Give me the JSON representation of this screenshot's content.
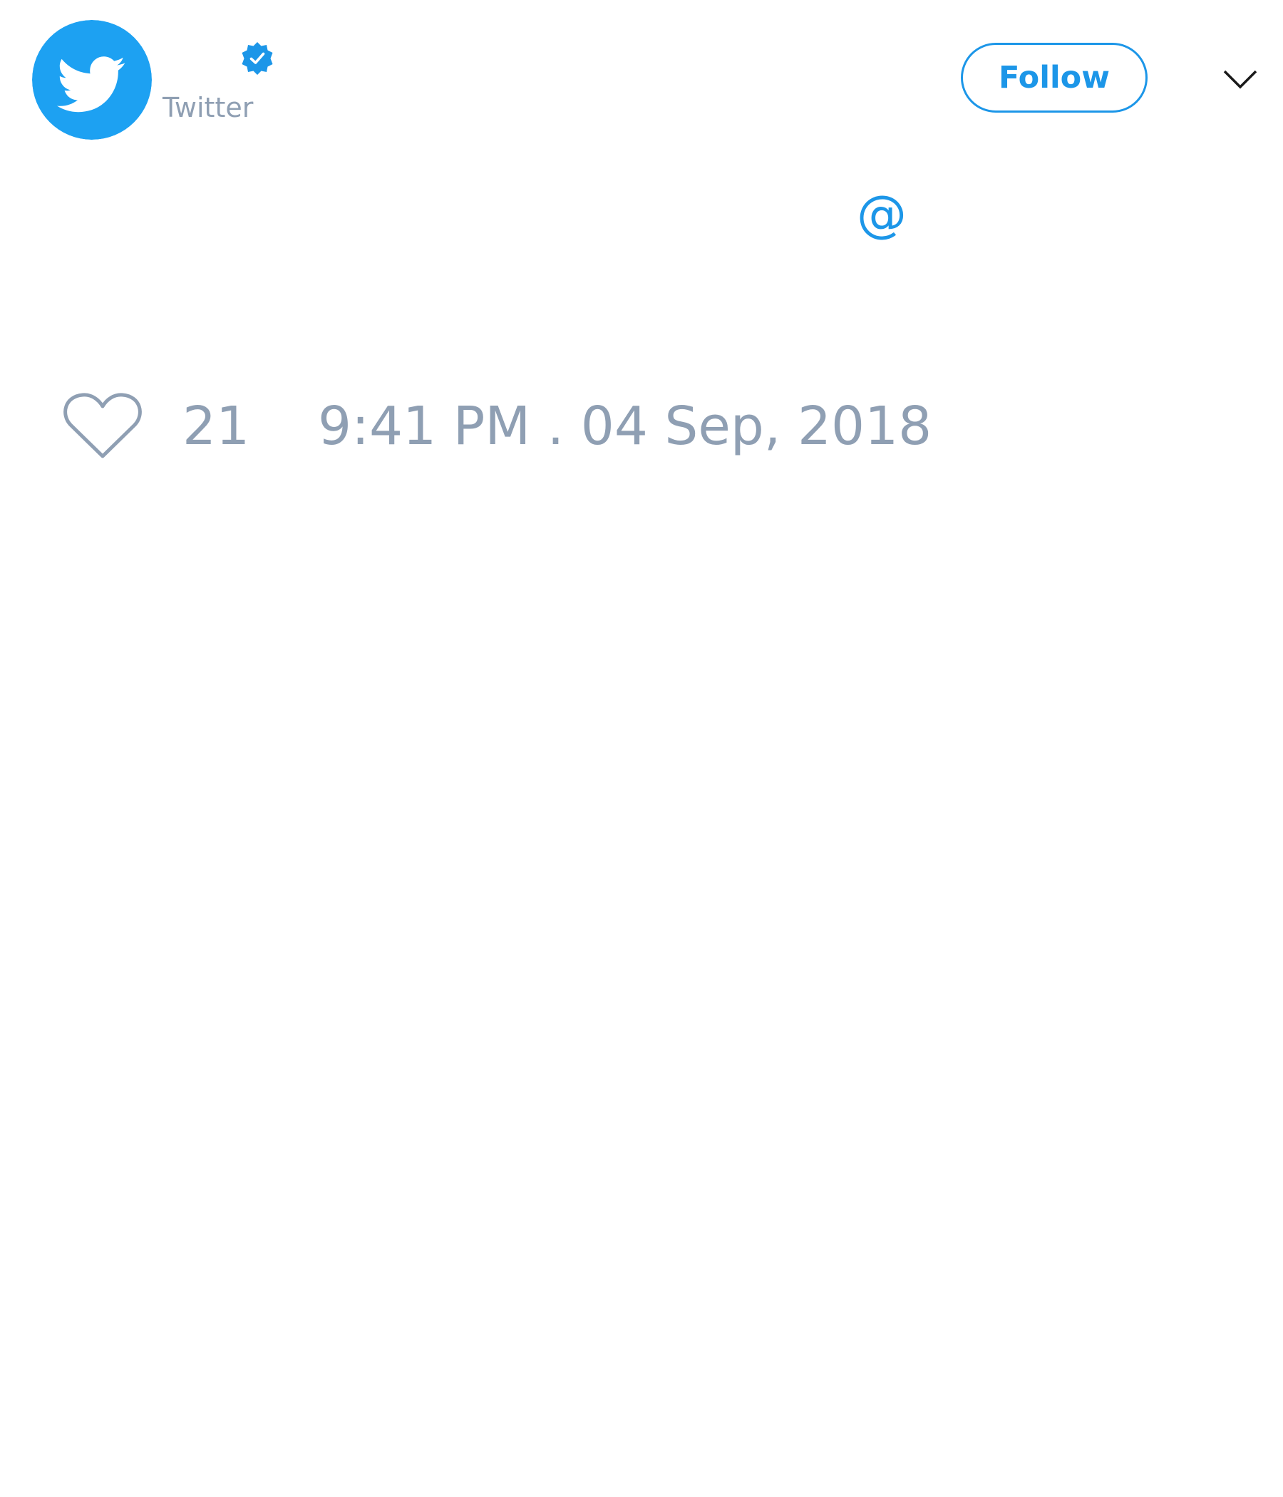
{
  "tweet": {
    "author": {
      "handle": "Twitter",
      "avatar_icon": "twitter-bird-icon",
      "verified_icon": "verified-badge-icon"
    },
    "follow_label": "Follow",
    "menu_icon": "chevron-down-icon",
    "body": {
      "mention_prefix": "@"
    },
    "likes": {
      "icon": "heart-icon",
      "count": "21"
    },
    "timestamp": "9:41 PM . 04 Sep, 2018"
  },
  "colors": {
    "accent": "#1c96e8",
    "muted_text": "#8f9fb3",
    "avatar_bg": "#1da1f2",
    "background": "#ffffff"
  }
}
